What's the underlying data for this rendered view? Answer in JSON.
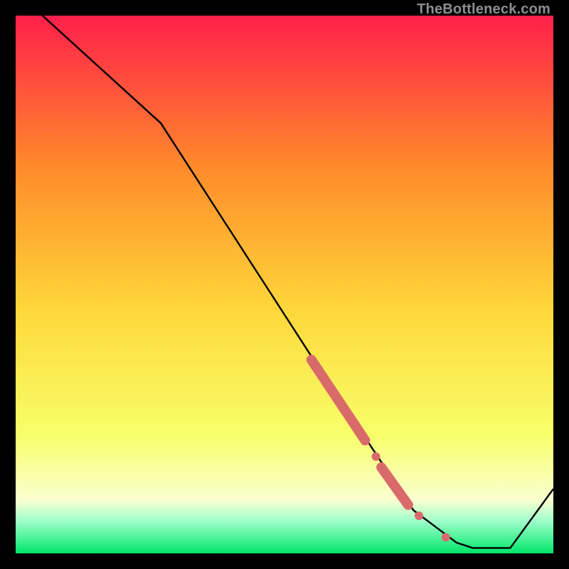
{
  "watermark": "TheBottleneck.com",
  "colors": {
    "gradient_top": "#ff1f4a",
    "gradient_mid_upper": "#ff8a2b",
    "gradient_mid": "#ffd83a",
    "gradient_lower": "#f7ff6a",
    "gradient_pale": "#fbffd0",
    "gradient_green_pale": "#9fffc9",
    "gradient_green": "#00e66b",
    "line": "#000000",
    "marker": "#d96a6a"
  },
  "chart_data": {
    "type": "line",
    "title": "",
    "xlabel": "",
    "ylabel": "",
    "xlim": [
      0,
      100
    ],
    "ylim": [
      0,
      100
    ],
    "series": [
      {
        "name": "curve",
        "x": [
          0,
          5,
          27,
          58,
          62,
          66,
          70,
          74,
          78,
          82,
          85,
          92,
          100
        ],
        "values": [
          105,
          100,
          80,
          32,
          26,
          20,
          14,
          8,
          5,
          2,
          1,
          1,
          12
        ]
      }
    ],
    "highlights": [
      {
        "name": "thick-segment-upper",
        "x_range": [
          55,
          65
        ],
        "y_range": [
          36,
          21
        ],
        "style": "thick"
      },
      {
        "name": "dot-1",
        "x": 67,
        "y": 18
      },
      {
        "name": "thick-segment-mid",
        "x_range": [
          68,
          73
        ],
        "y_range": [
          16,
          9
        ],
        "style": "thick"
      },
      {
        "name": "dot-2",
        "x": 75,
        "y": 7
      },
      {
        "name": "dot-3",
        "x": 80,
        "y": 3
      }
    ]
  }
}
